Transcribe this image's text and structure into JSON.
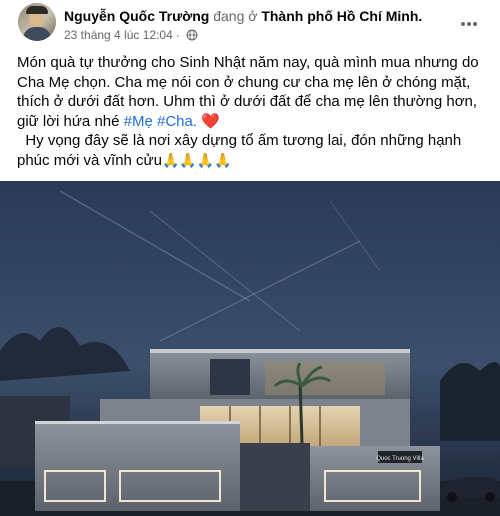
{
  "post": {
    "author": "Nguyễn Quốc Trường",
    "dang_o": "đang ở",
    "location": "Thành phố Hồ Chí Minh.",
    "date": "23 tháng 4 lúc 12:04",
    "dot": "·",
    "body_line1": "Món quà tự thưởng cho Sinh Nhật năm nay, quà mình mua nhưng do",
    "body_line2": "Cha Mẹ chọn. Cha mẹ nói con ở chung cư cha mẹ lên ở chóng mặt,",
    "body_line3": "thích ở dưới đất hơn. Uhm thì ở dưới đất để cha mẹ lên thường hơn,",
    "body_line4_prefix": "giữ lời hứa nhé ",
    "hashtag_me": "#Mẹ",
    "hashtag_cha": "#Cha.",
    "heart": "❤️",
    "body_line5": "  Hy vọng đây sẽ là nơi xây dựng tổ ấm tương lai, đón những hạnh",
    "body_line6": "phúc mới và vĩnh cửu",
    "prayer_emojis": "🙏🙏🙏🙏",
    "house_sign": "Quoc Truong Villa"
  },
  "icons": {
    "privacy": "globe-icon",
    "more": "more-options-icon"
  },
  "colors": {
    "link": "#216fdb",
    "meta": "#65676b",
    "sky_top": "#2c3b58",
    "sky_bottom": "#121a2c"
  }
}
